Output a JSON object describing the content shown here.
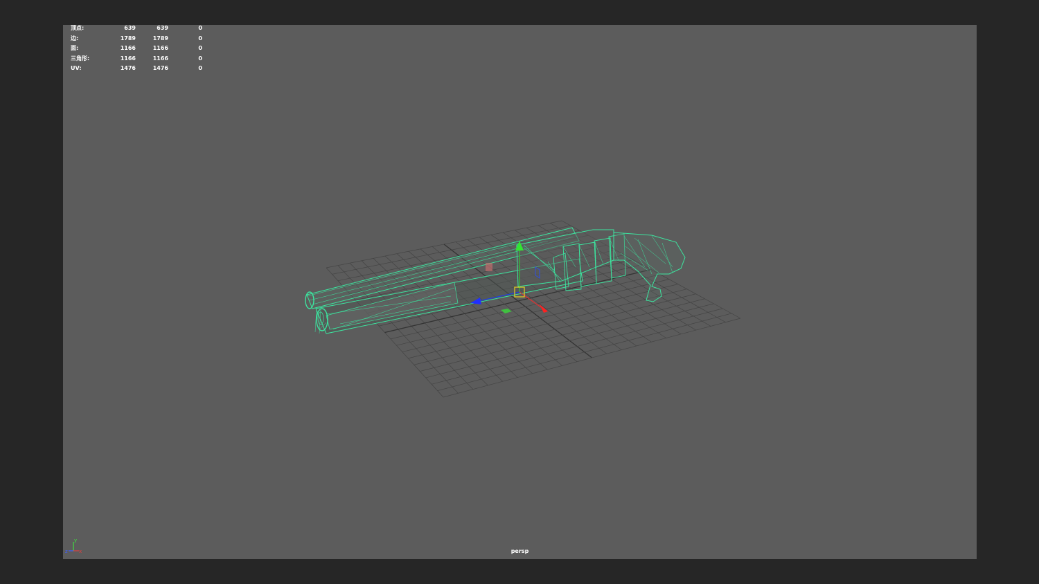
{
  "hud": {
    "rows": [
      {
        "label": "顶点:",
        "v1": "639",
        "v2": "639",
        "v3": "0"
      },
      {
        "label": "边:",
        "v1": "1789",
        "v2": "1789",
        "v3": "0"
      },
      {
        "label": "面:",
        "v1": "1166",
        "v2": "1166",
        "v3": "0"
      },
      {
        "label": "三角形:",
        "v1": "1166",
        "v2": "1166",
        "v3": "0"
      },
      {
        "label": "UV:",
        "v1": "1476",
        "v2": "1476",
        "v3": "0"
      }
    ]
  },
  "viewport": {
    "camera": "persp",
    "background": "#5c5c5c",
    "grid_color": "#3f3f3f",
    "wire_color": "#3ce6a0",
    "axis_labels": {
      "x": "x",
      "y": "y",
      "z": "z"
    }
  }
}
